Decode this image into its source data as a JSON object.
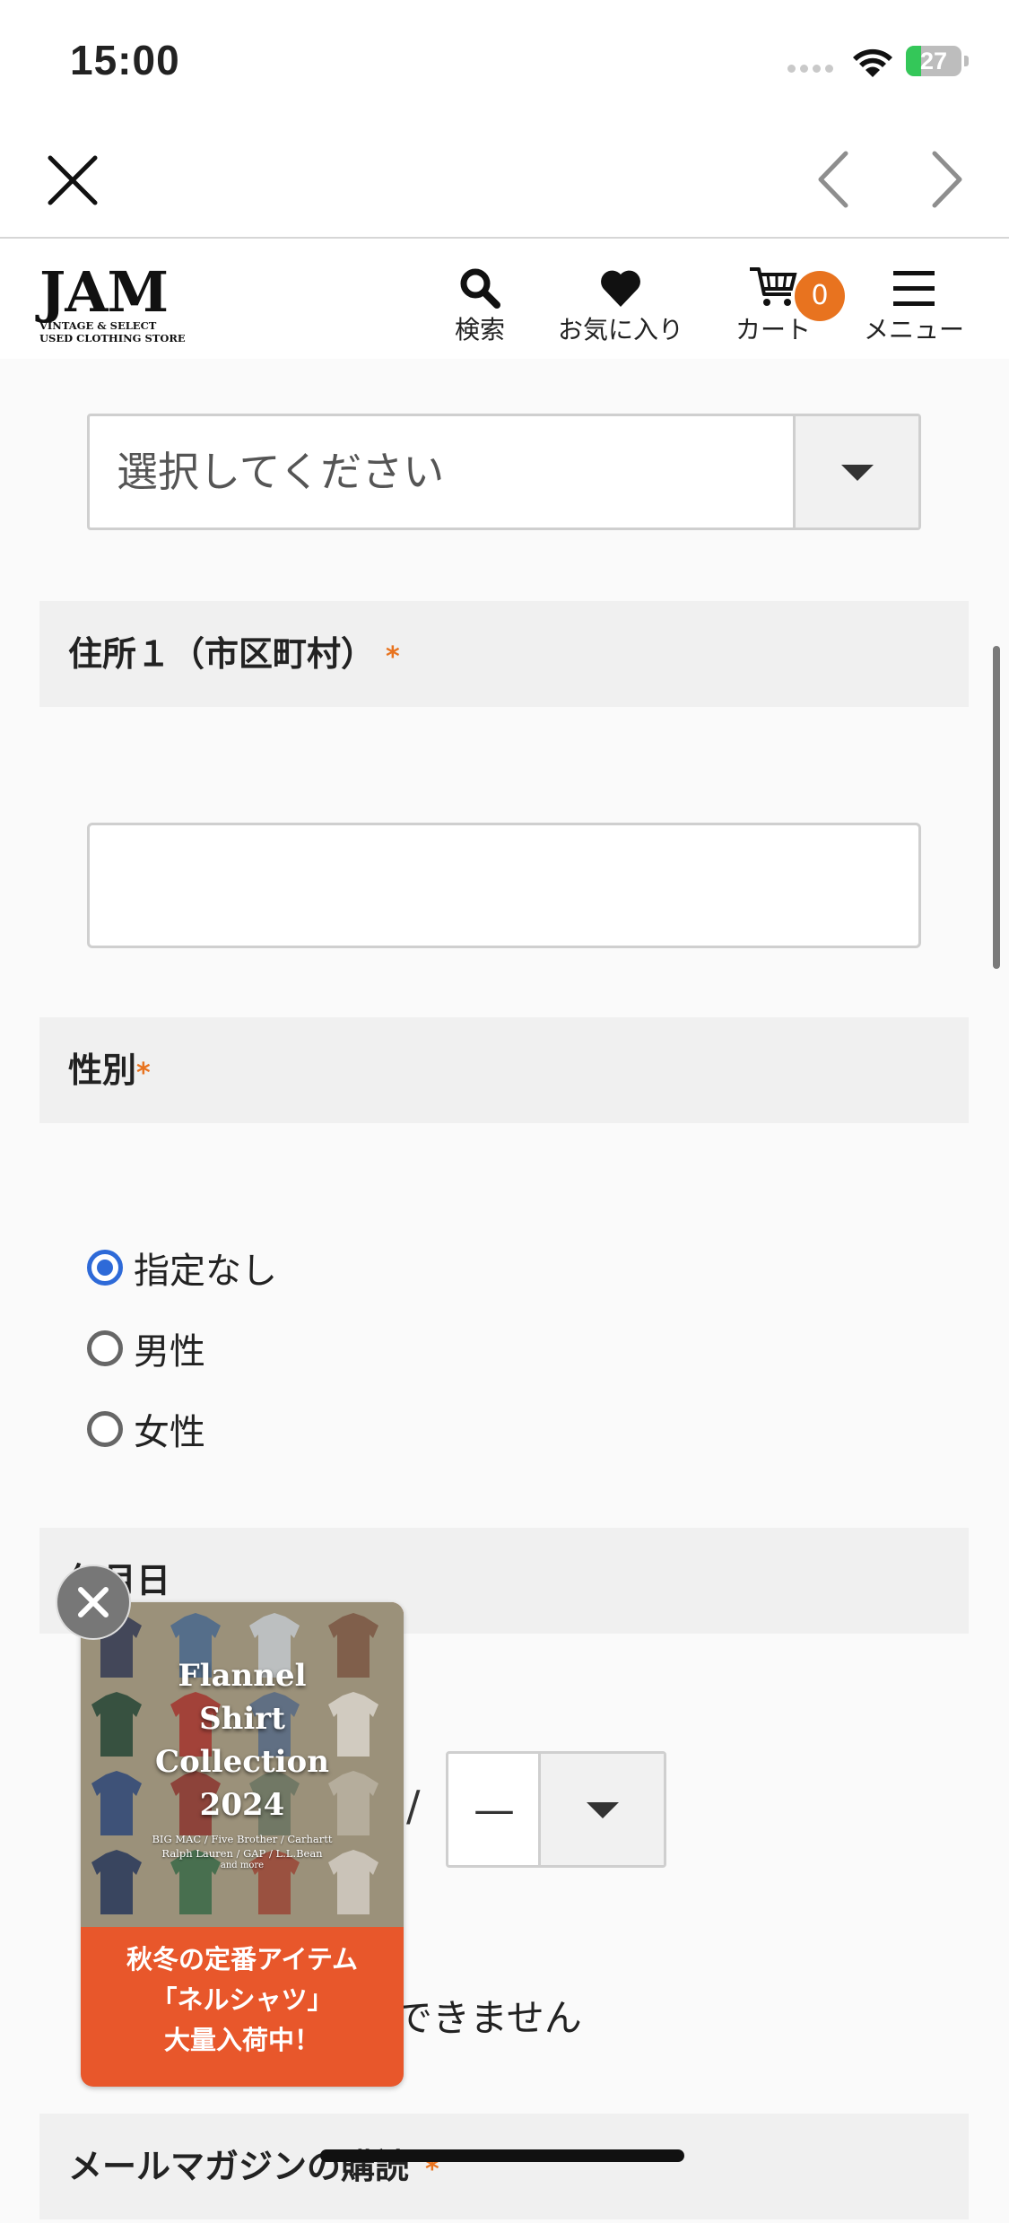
{
  "status_bar": {
    "time": "15:00",
    "battery_level": "27",
    "battery_fraction": 0.27
  },
  "browser_nav": {
    "close_icon": "close-icon",
    "back_icon": "chevron-left-icon",
    "forward_icon": "chevron-right-icon"
  },
  "header": {
    "logo_main": "JAM",
    "logo_line1": "VINTAGE & SELECT",
    "logo_line2": "USED CLOTHING STORE",
    "search_label": "検索",
    "favorites_label": "お気に入り",
    "cart_label": "カート",
    "cart_count": "0",
    "menu_label": "メニュー",
    "accent_color": "#e8731f"
  },
  "form": {
    "prefecture_select": {
      "value": "選択してください"
    },
    "address1": {
      "label": "住所１（市区町村）",
      "required_mark": "*",
      "value": ""
    },
    "gender": {
      "label": "性別",
      "required_mark": "*",
      "options": [
        {
          "label": "指定なし",
          "checked": true
        },
        {
          "label": "男性",
          "checked": false
        },
        {
          "label": "女性",
          "checked": false
        }
      ]
    },
    "birthday": {
      "label_visible": "年月日",
      "separator": "/",
      "day_value": "—",
      "note_visible": "できません"
    },
    "newsletter": {
      "label_visible": "メールマガジンの購読",
      "required_mark": "*"
    }
  },
  "banner": {
    "title_lines": [
      "Flannel",
      "Shirt",
      "Collection",
      "2024"
    ],
    "brands_line1": "BIG MAC / Five Brother / Carhartt",
    "brands_line2": "Ralph Lauren / GAP / L.L.Bean",
    "and_more": "and more",
    "text_lines": [
      "秋冬の定番アイテム",
      "「ネルシャツ」",
      "大量入荷中！"
    ],
    "background_color": "#e8572b"
  }
}
